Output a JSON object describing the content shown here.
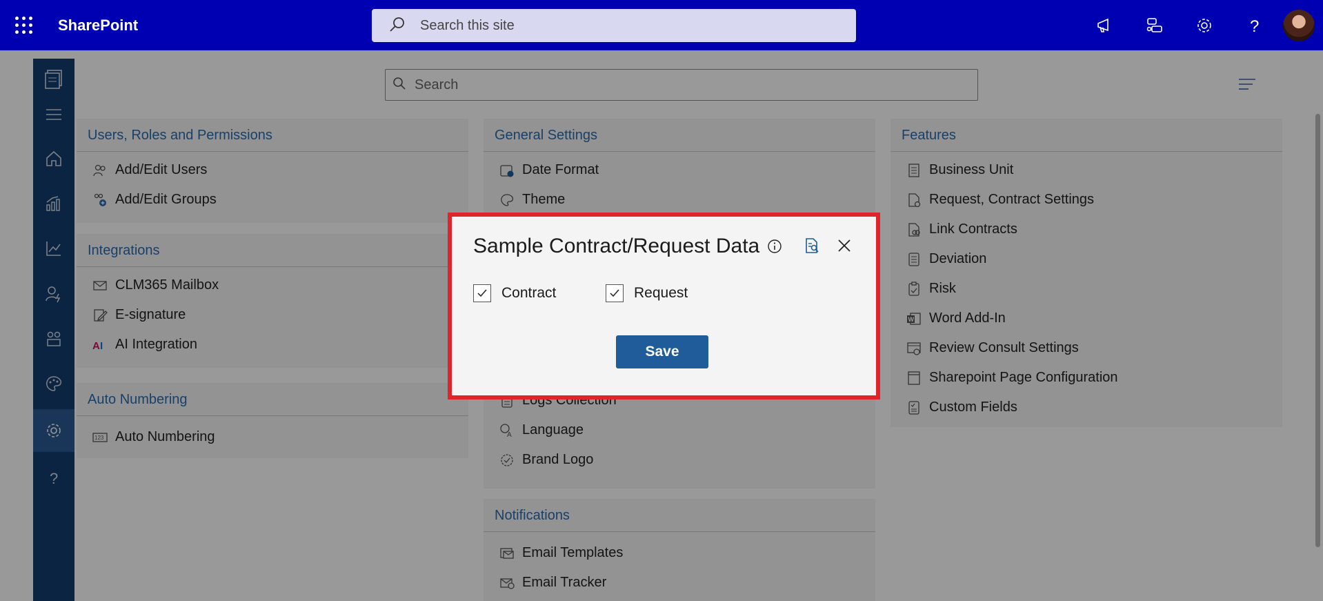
{
  "suitebar": {
    "app_name": "SharePoint",
    "search_placeholder": "Search this site",
    "bg_color": "#0000b3",
    "icons": [
      "waffle-icon",
      "megaphone-icon",
      "chat-icon",
      "gear-icon",
      "help-icon",
      "avatar"
    ]
  },
  "content": {
    "search_placeholder": "Search"
  },
  "rail": {
    "items": [
      "clm-logo-icon",
      "hamburger-icon",
      "home-icon",
      "analytics-icon",
      "chart-icon",
      "user-settings-icon",
      "people-icon",
      "palette-icon",
      "gear-icon",
      "help-icon"
    ],
    "active": "gear-icon",
    "bg_color": "#123c6e"
  },
  "panels": {
    "users": {
      "title": "Users, Roles and Permissions",
      "items": [
        "Add/Edit Users",
        "Add/Edit Groups"
      ]
    },
    "integrations": {
      "title": "Integrations",
      "items": [
        "CLM365 Mailbox",
        "E-signature",
        "AI Integration"
      ]
    },
    "auto_numbering": {
      "title": "Auto Numbering",
      "items": [
        "Auto Numbering"
      ]
    },
    "general": {
      "title": "General Settings",
      "items": [
        "Date Format",
        "Theme",
        "Logs Collection",
        "Language",
        "Brand Logo"
      ]
    },
    "notifications": {
      "title": "Notifications",
      "items": [
        "Email Templates",
        "Email Tracker"
      ]
    },
    "features": {
      "title": "Features",
      "items": [
        "Business Unit",
        "Request, Contract Settings",
        "Link Contracts",
        "Deviation",
        "Risk",
        "Word Add-In",
        "Review Consult Settings",
        "Sharepoint Page Configuration",
        "Custom Fields"
      ]
    }
  },
  "dialog": {
    "title": "Sample Contract/Request Data",
    "checkboxes": [
      {
        "label": "Contract",
        "checked": true
      },
      {
        "label": "Request",
        "checked": true
      }
    ],
    "save_label": "Save",
    "highlight_color": "#e0242b",
    "button_color": "#1f5c99"
  }
}
